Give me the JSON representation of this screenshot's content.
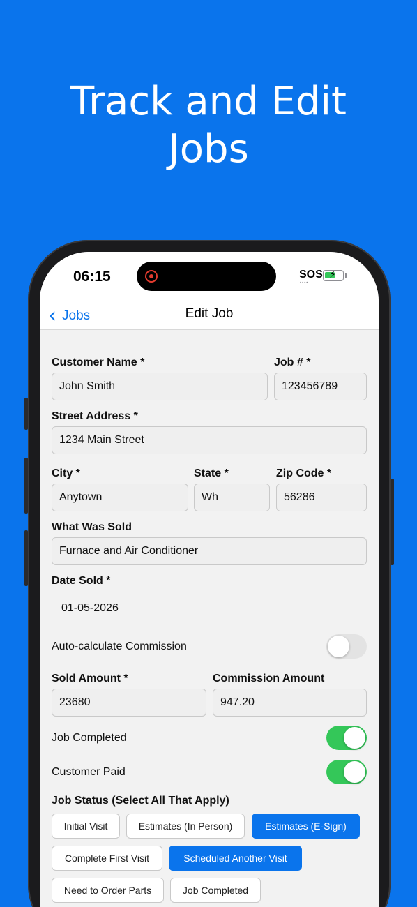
{
  "headline": [
    "Track and Edit",
    "Jobs"
  ],
  "status_bar": {
    "time": "06:15",
    "sos": "SOS",
    "sos_dots": "••••"
  },
  "nav": {
    "back_label": "Jobs",
    "back_icon": "chevron-left-icon",
    "title": "Edit Job"
  },
  "form": {
    "customer_name": {
      "label": "Customer Name *",
      "value": "John Smith"
    },
    "job_number": {
      "label": "Job # *",
      "value": "123456789"
    },
    "street_address": {
      "label": "Street Address *",
      "value": "1234 Main Street"
    },
    "city": {
      "label": "City *",
      "value": "Anytown"
    },
    "state": {
      "label": "State *",
      "value": "Wh"
    },
    "zip": {
      "label": "Zip Code *",
      "value": "56286"
    },
    "what_was_sold": {
      "label": "What Was Sold",
      "value": "Furnace and Air Conditioner"
    },
    "date_sold": {
      "label": "Date Sold *",
      "value": "01-05-2026"
    },
    "auto_commission": {
      "label": "Auto-calculate Commission",
      "on": false
    },
    "sold_amount": {
      "label": "Sold Amount *",
      "value": "23680"
    },
    "commission_amount": {
      "label": "Commission Amount",
      "value": "947.20"
    },
    "job_completed": {
      "label": "Job Completed",
      "on": true
    },
    "customer_paid": {
      "label": "Customer Paid",
      "on": true
    },
    "job_status": {
      "label": "Job Status (Select All That Apply)",
      "chips": [
        {
          "label": "Initial Visit",
          "selected": false
        },
        {
          "label": "Estimates (In Person)",
          "selected": false
        },
        {
          "label": "Estimates (E-Sign)",
          "selected": true
        },
        {
          "label": "Complete First Visit",
          "selected": false
        },
        {
          "label": "Scheduled Another Visit",
          "selected": true
        },
        {
          "label": "Need to Order Parts",
          "selected": false
        },
        {
          "label": "Job Completed",
          "selected": false
        }
      ]
    }
  },
  "colors": {
    "background": "#0A74EC",
    "accent": "#0A74EC",
    "toggle_on": "#34c759"
  }
}
